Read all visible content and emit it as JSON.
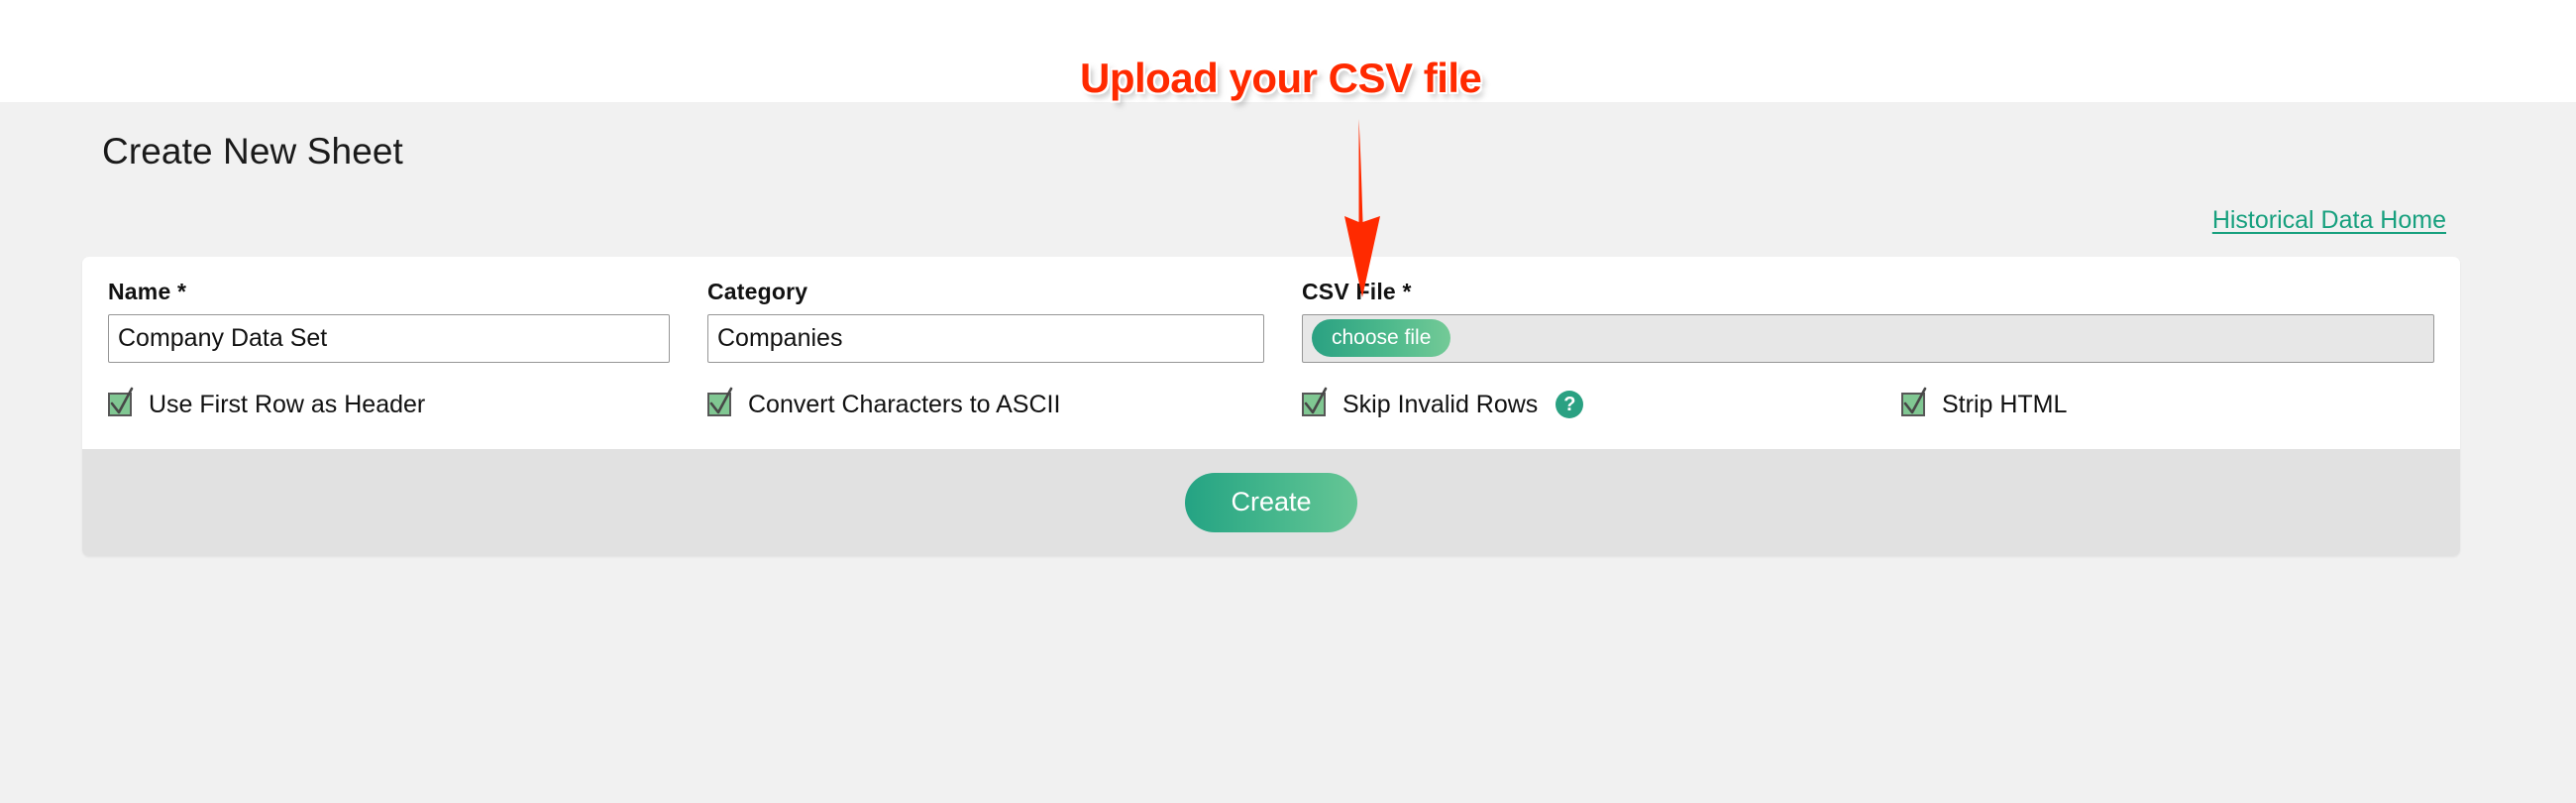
{
  "annotation": {
    "text": "Upload your CSV file",
    "arrow_icon": "down-arrow-icon",
    "color": "#ff2a00"
  },
  "page": {
    "title": "Create New Sheet",
    "background_color": "#f1f1f1",
    "top_band_color": "#ffffff"
  },
  "nav": {
    "home_link": "Historical Data Home",
    "link_color": "#17a07e"
  },
  "form": {
    "fields": [
      {
        "label": "Name *",
        "value": "Company Data Set",
        "placeholder": "",
        "type": "text"
      },
      {
        "label": "Category",
        "value": "Companies",
        "placeholder": "",
        "type": "text"
      },
      {
        "label": "CSV File *",
        "value": "",
        "type": "file",
        "button_label": "choose file"
      }
    ],
    "checkboxes": [
      {
        "label": "Use First Row as Header",
        "checked": true,
        "help": false
      },
      {
        "label": "Convert Characters to ASCII",
        "checked": true,
        "help": false
      },
      {
        "label": "Skip Invalid Rows",
        "checked": true,
        "help": true,
        "help_glyph": "?"
      },
      {
        "label": "Strip HTML",
        "checked": true,
        "help": false
      }
    ],
    "submit_label": "Create",
    "accent_color": "#2aa182",
    "checkbox_fill": "#80c792"
  }
}
